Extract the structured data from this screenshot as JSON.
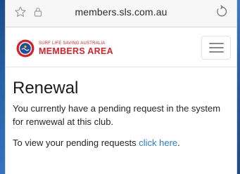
{
  "browser": {
    "url": "members.sls.com.au"
  },
  "brand": {
    "org_name": "SURF LIFE SAVING AUSTRALIA",
    "area_name": "MEMBERS AREA",
    "color": "#d0242b"
  },
  "main": {
    "title": "Renewal",
    "message": "You currently have a pending request in the system for renwewal at this club.",
    "view_prefix": "To view your pending requests ",
    "view_link": "click here",
    "view_suffix": "."
  },
  "icons": {
    "bookmark": "star-icon",
    "secure": "lock-icon",
    "reload": "reload-icon",
    "menu": "hamburger-icon",
    "logo": "sls-logo-icon"
  },
  "colors": {
    "link": "#2a7bc8",
    "accent": "#d0242b"
  }
}
